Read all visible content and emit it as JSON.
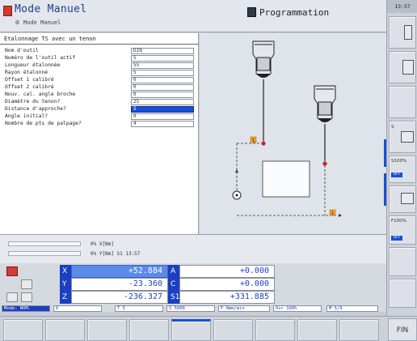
{
  "header": {
    "mode_title": "Mode Manuel",
    "mode_subtitle": "Mode Manuel",
    "program_title": "Programmation"
  },
  "clock": "13:57",
  "form": {
    "title": "Etalonnage TS avec un tenon",
    "rows": [
      {
        "label": "Nom d'outil",
        "value": "DIN"
      },
      {
        "label": "Numéro de l'outil actif",
        "value": "5"
      },
      {
        "label": "Longueur étalonnée",
        "value": "55"
      },
      {
        "label": "Rayon étalonné",
        "value": "5"
      },
      {
        "label": "Offset 1 calibré",
        "value": "0"
      },
      {
        "label": "Offset 2 calibré",
        "value": "0"
      },
      {
        "label": "Nouv. cal. angle broche",
        "value": "0"
      },
      {
        "label": "Diamètre du tenon?",
        "value": "25"
      },
      {
        "label": "Distance d'approche?",
        "value": "5"
      },
      {
        "label": "Angle initial?",
        "value": "0"
      },
      {
        "label": "Nombre de pts de palpage?",
        "value": "4"
      }
    ],
    "active_row_index": 8
  },
  "status": {
    "line1": "0% X[Nm]",
    "line2": "0% Y[Nm] S1   13:57",
    "progress1": 0,
    "progress2": 0
  },
  "coordinates": [
    {
      "axis": "X",
      "value": "+52.884",
      "highlight": true
    },
    {
      "axis": "Y",
      "value": "-23.360",
      "highlight": false
    },
    {
      "axis": "Z",
      "value": "-236.327",
      "highlight": false
    },
    {
      "axis": "A",
      "value": "+0.000",
      "highlight": false
    },
    {
      "axis": "C",
      "value": "+0.000",
      "highlight": false
    },
    {
      "axis": "S1",
      "value": "+331.885",
      "highlight": false
    }
  ],
  "info_strip": {
    "mode": "Mode: NOM.",
    "cell2": "0",
    "cell3": "T 5",
    "cell4": "S 5000",
    "cell5": "F 0mm/min",
    "cell6": "Ovr 100%",
    "cell7": "M 5/9"
  },
  "sidebar_keys": [
    {
      "label": "S",
      "badge": ""
    },
    {
      "label": "S100%",
      "badge": "OFF"
    },
    {
      "label": "F100%",
      "badge": "OFF"
    }
  ],
  "softkeys": [
    "",
    "",
    "",
    "",
    "",
    "",
    "",
    "",
    ""
  ],
  "fin_label": "FIN",
  "graphic": {
    "marker_label": "1"
  },
  "colors": {
    "accent": "#1a4fd6",
    "probe_red": "#c8202a",
    "marker": "#f0a020"
  }
}
